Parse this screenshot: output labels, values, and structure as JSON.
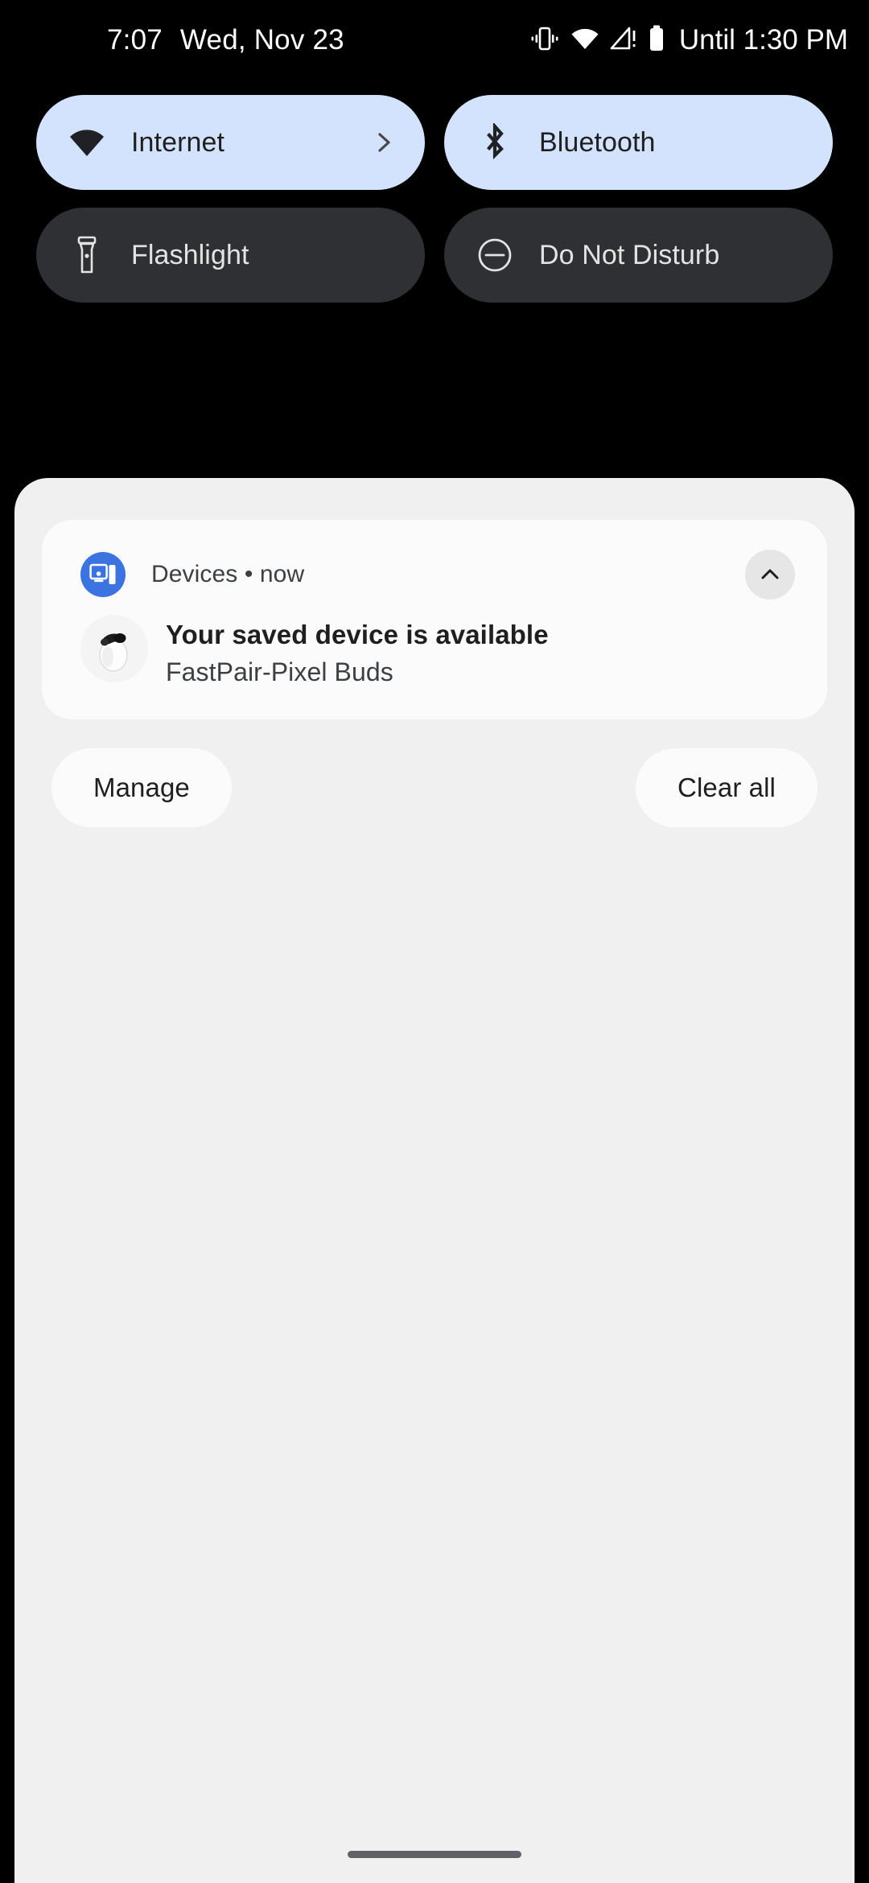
{
  "status_bar": {
    "time": "7:07",
    "date": "Wed, Nov 23",
    "battery_estimate": "Until 1:30 PM",
    "icons": [
      "vibrate-icon",
      "wifi-icon",
      "no-sim-signal-icon",
      "battery-icon"
    ]
  },
  "quick_settings": {
    "tiles": [
      {
        "id": "internet",
        "label": "Internet",
        "icon": "wifi-icon",
        "state": "on",
        "has_chevron": true
      },
      {
        "id": "bluetooth",
        "label": "Bluetooth",
        "icon": "bluetooth-icon",
        "state": "on",
        "has_chevron": false
      },
      {
        "id": "flashlight",
        "label": "Flashlight",
        "icon": "flashlight-icon",
        "state": "off",
        "has_chevron": false
      },
      {
        "id": "do-not-disturb",
        "label": "Do Not Disturb",
        "icon": "do-not-disturb-icon",
        "state": "off",
        "has_chevron": false
      }
    ],
    "colors": {
      "tile_on": "#d3e3fd",
      "tile_off": "#2f3033",
      "label_on": "#1f1f1f",
      "label_off": "#e3e3e3"
    }
  },
  "shade": {
    "background": "#f0f0f1",
    "notification": {
      "app_name": "Devices",
      "separator": "•",
      "time": "now",
      "header_text": "Devices • now",
      "title": "Your saved device is available",
      "subtitle": "FastPair-Pixel Buds",
      "app_icon": "devices-icon",
      "app_icon_color": "#3b74e0",
      "collapse_icon": "chevron-up-icon",
      "thumbnail": "pixel-buds-image"
    },
    "actions": {
      "manage": "Manage",
      "clear_all": "Clear all"
    }
  },
  "navigation": {
    "handle": "gesture-nav-handle"
  }
}
